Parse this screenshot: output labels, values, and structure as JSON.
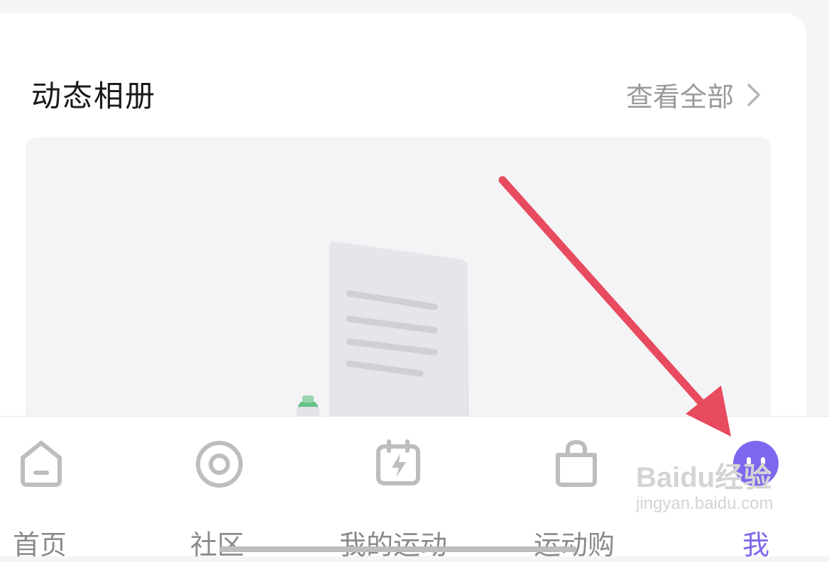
{
  "album": {
    "title": "动态相册",
    "view_all_label": "查看全部"
  },
  "tabbar": {
    "items": [
      {
        "label": "首页",
        "icon": "home-icon"
      },
      {
        "label": "社区",
        "icon": "community-icon"
      },
      {
        "label": "我的运动",
        "icon": "calendar-bolt-icon"
      },
      {
        "label": "运动购",
        "icon": "shopping-bag-icon"
      },
      {
        "label": "我",
        "icon": "avatar-icon",
        "active": true
      }
    ]
  },
  "watermark": {
    "main": "Baidu经验",
    "sub": "jingyan.baidu.com"
  },
  "colors": {
    "accent": "#7b68ee",
    "arrow": "#e84a5f",
    "inactive": "#8a8a8a"
  }
}
